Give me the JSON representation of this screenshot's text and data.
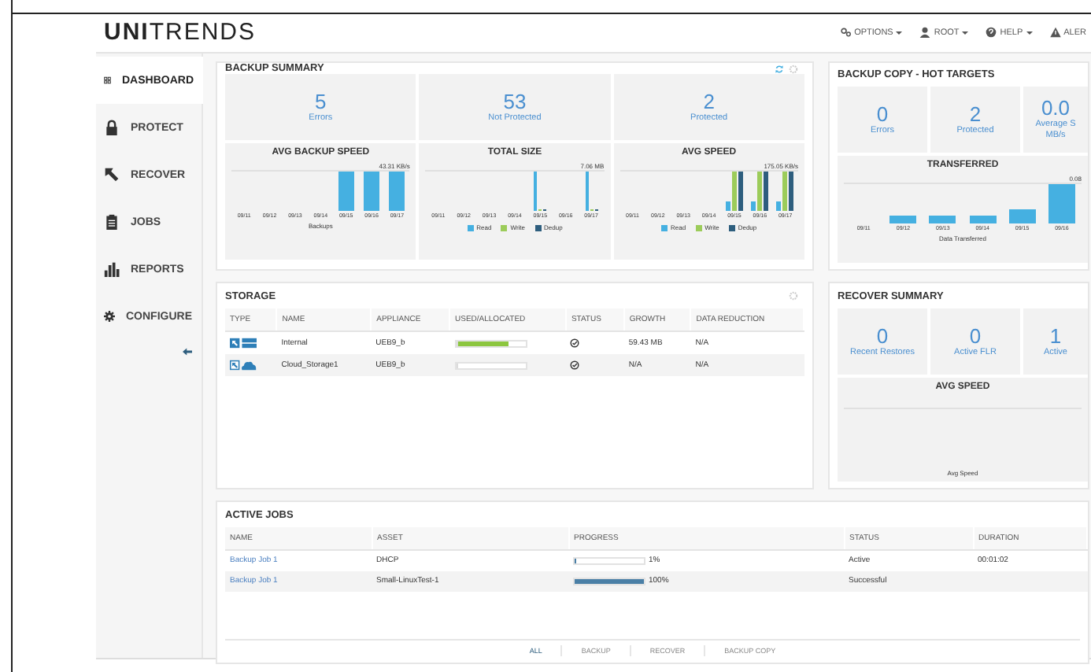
{
  "brand": {
    "strong": "UNI",
    "light": "TRENDS"
  },
  "top_menu": [
    {
      "kind": "options",
      "label": "OPTIONS"
    },
    {
      "kind": "user",
      "label": "ROOT"
    },
    {
      "kind": "help",
      "label": "HELP"
    },
    {
      "kind": "alert",
      "label": "ALER"
    }
  ],
  "sidebar": {
    "items": [
      {
        "kind": "dashboard",
        "label": "DASHBOARD",
        "selected": true
      },
      {
        "kind": "protect",
        "label": "PROTECT",
        "selected": false
      },
      {
        "kind": "recover",
        "label": "RECOVER",
        "selected": false
      },
      {
        "kind": "jobs",
        "label": "JOBS",
        "selected": false
      },
      {
        "kind": "reports",
        "label": "REPORTS",
        "selected": false
      },
      {
        "kind": "configure",
        "label": "CONFIGURE",
        "selected": false
      }
    ]
  },
  "backup_summary": {
    "title": "BACKUP SUMMARY",
    "stats": [
      {
        "value": "5",
        "label": "Errors"
      },
      {
        "value": "53",
        "label": "Not Protected"
      },
      {
        "value": "2",
        "label": "Protected"
      }
    ],
    "charts": [
      {
        "kind": "speed",
        "title": "AVG BACKUP SPEED",
        "max_label": "43.31 KB/s",
        "x_labels": [
          "09/11",
          "09/12",
          "09/13",
          "09/14",
          "09/15",
          "09/16",
          "09/17"
        ],
        "caption": "Backups"
      },
      {
        "kind": "size",
        "title": "TOTAL SIZE",
        "max_label": "7.06 MB",
        "x_labels": [
          "09/11",
          "09/12",
          "09/13",
          "09/14",
          "09/15",
          "09/16",
          "09/17"
        ],
        "legend": [
          {
            "label": "Read",
            "color": "#45b0e1"
          },
          {
            "label": "Write",
            "color": "#9ccc5a"
          },
          {
            "label": "Dedup",
            "color": "#2e5e7e"
          }
        ]
      },
      {
        "kind": "rwd",
        "title": "AVG SPEED",
        "max_label": "175.05 KB/s",
        "x_labels": [
          "09/11",
          "09/12",
          "09/13",
          "09/14",
          "09/15",
          "09/16",
          "09/17"
        ],
        "legend": [
          {
            "label": "Read",
            "color": "#45b0e1"
          },
          {
            "label": "Write",
            "color": "#9ccc5a"
          },
          {
            "label": "Dedup",
            "color": "#2e5e7e"
          }
        ]
      }
    ]
  },
  "hot_targets": {
    "title": "BACKUP COPY - HOT TARGETS",
    "stats": [
      {
        "value": "0",
        "label": "Errors"
      },
      {
        "value": "2",
        "label": "Protected"
      },
      {
        "value": "0.0",
        "label": "Average S",
        "label_2": "MB/s"
      }
    ],
    "chart": {
      "kind": "transferred",
      "title": "TRANSFERRED",
      "max_label": "0.08",
      "x_labels": [
        "09/11",
        "09/12",
        "09/13",
        "09/14",
        "09/15",
        "09/16"
      ],
      "caption": "Data Transferred"
    }
  },
  "storage": {
    "title": "STORAGE",
    "columns": [
      "TYPE",
      "NAME",
      "APPLIANCE",
      "USED/ALLOCATED",
      "STATUS",
      "GROWTH",
      "DATA REDUCTION"
    ],
    "rows": [
      {
        "kind": "internal",
        "name": "Internal",
        "appliance": "UEB9_b",
        "level": 0.75,
        "growth": "59.43 MB",
        "data_reduction": "N/A"
      },
      {
        "kind": "cloud",
        "name": "Cloud_Storage1",
        "appliance": "UEB9_b",
        "level": 0,
        "growth": "N/A",
        "data_reduction": "N/A"
      }
    ]
  },
  "recover_summary": {
    "title": "RECOVER SUMMARY",
    "stats": [
      {
        "value": "0",
        "label": "Recent Restores"
      },
      {
        "value": "0",
        "label": "Active FLR"
      },
      {
        "value": "1",
        "label": "Active"
      }
    ],
    "chart": {
      "title": "AVG SPEED",
      "caption": "Avg Speed"
    }
  },
  "active_jobs": {
    "title": "ACTIVE JOBS",
    "columns": [
      "NAME",
      "ASSET",
      "PROGRESS",
      "STATUS",
      "DURATION"
    ],
    "rows": [
      {
        "name": "Backup Job 1",
        "asset": "DHCP",
        "level": 0.01,
        "progress": "1%",
        "status": "Active",
        "duration": "00:01:02"
      },
      {
        "name": "Backup Job 1",
        "asset": "Small-LinuxTest-1",
        "level": 1,
        "progress": "100%",
        "status": "Successful"
      }
    ],
    "filters": [
      {
        "label": "ALL",
        "selected": true
      },
      {
        "label": "BACKUP",
        "selected": false
      },
      {
        "label": "RECOVER",
        "selected": false
      },
      {
        "label": "BACKUP COPY",
        "selected": false
      }
    ]
  }
}
